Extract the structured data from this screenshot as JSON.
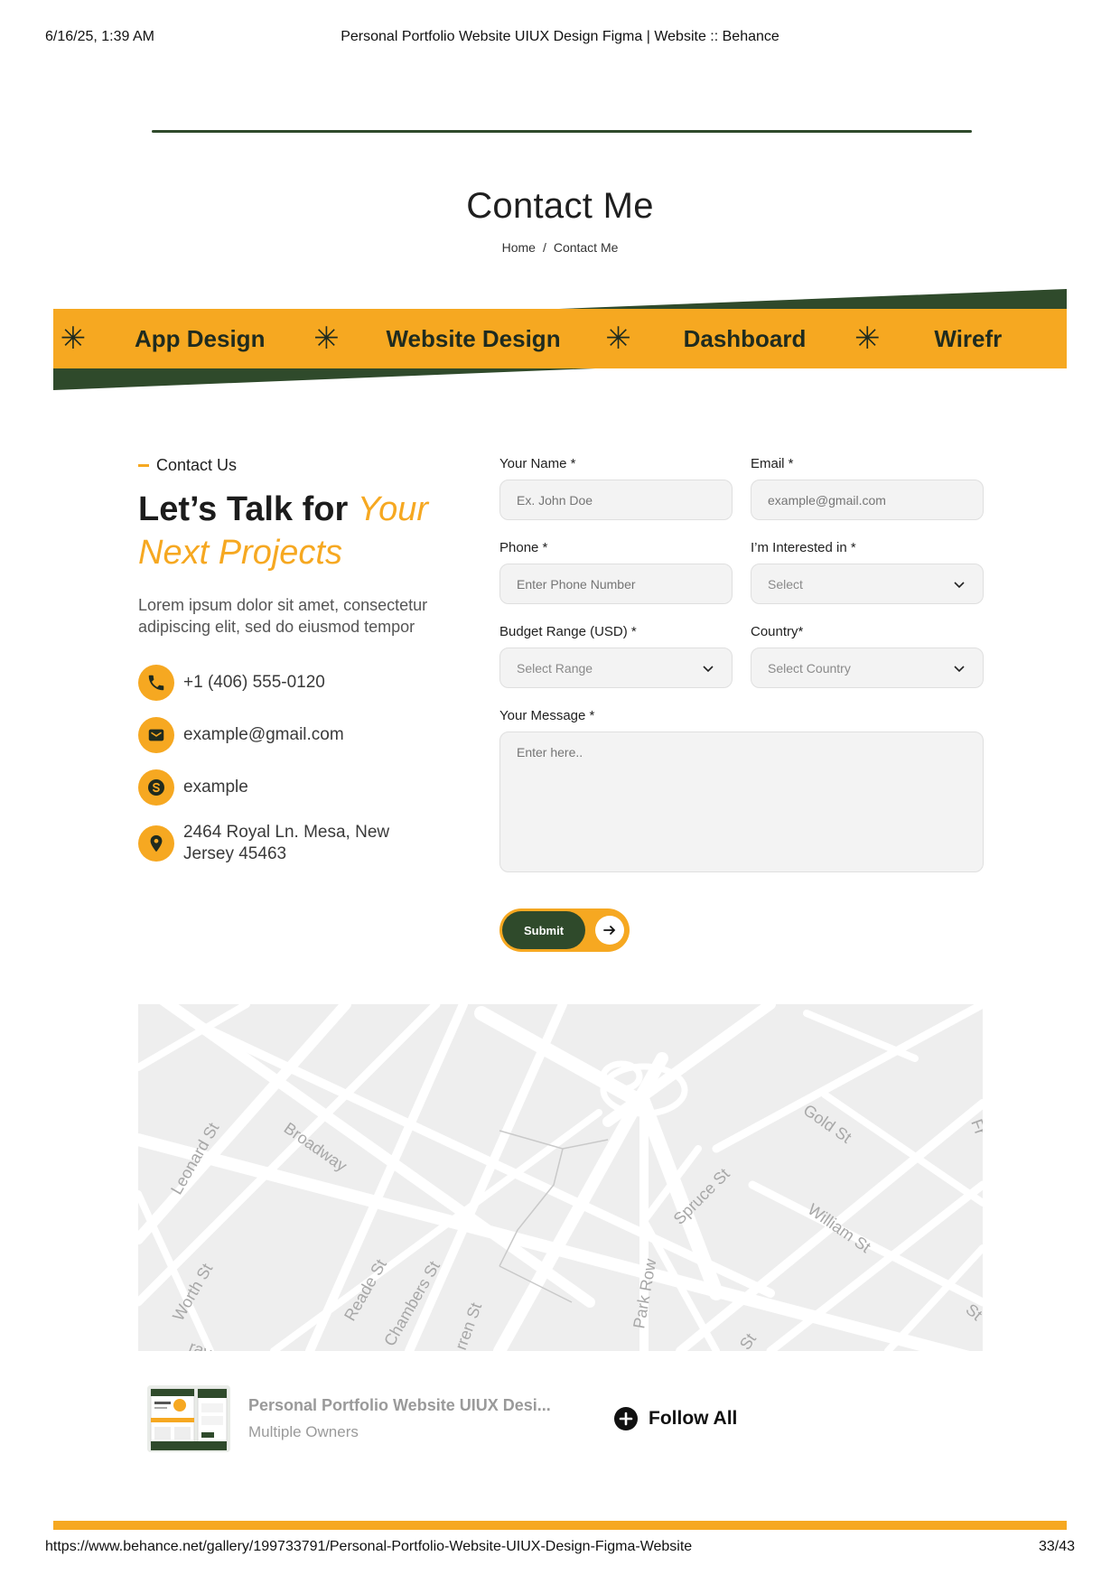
{
  "print_header": {
    "datetime": "6/16/25, 1:39 AM",
    "title": "Personal Portfolio Website UIUX Design Figma | Website :: Behance"
  },
  "page": {
    "title": "Contact Me",
    "breadcrumb": {
      "home": "Home",
      "separator": "/",
      "current": "Contact Me"
    }
  },
  "ribbon": {
    "items": [
      "App Design",
      "Website Design",
      "Dashboard",
      "Wirefr"
    ],
    "star_icon": "asterisk-icon",
    "colors": {
      "band": "#f6a821",
      "dark": "#2f4a2b"
    }
  },
  "contact_intro": {
    "eyebrow": "Contact Us",
    "headline_plain": "Let’s Talk for ",
    "headline_accent_1": "Your",
    "headline_accent_2": "Next Projects",
    "body": "Lorem ipsum dolor sit amet, consectetur adipiscing elit, sed do eiusmod tempor"
  },
  "contact_details": [
    {
      "icon": "phone-icon",
      "text": "+1 (406) 555-0120"
    },
    {
      "icon": "mail-icon",
      "text": "example@gmail.com"
    },
    {
      "icon": "skype-icon",
      "text": "example"
    },
    {
      "icon": "location-pin-icon",
      "text": "2464 Royal Ln. Mesa, New Jersey 45463"
    }
  ],
  "form": {
    "name": {
      "label": "Your Name *",
      "placeholder": "Ex. John Doe"
    },
    "email": {
      "label": "Email *",
      "placeholder": "example@gmail.com"
    },
    "phone": {
      "label": "Phone *",
      "placeholder": "Enter Phone Number"
    },
    "interest": {
      "label": "I’m Interested in *",
      "value": "Select"
    },
    "budget": {
      "label": "Budget Range (USD) *",
      "value": "Select Range"
    },
    "country": {
      "label": "Country*",
      "value": "Select Country"
    },
    "message": {
      "label": "Your Message *",
      "placeholder": "Enter here.."
    },
    "submit": "Submit"
  },
  "map": {
    "streets": [
      "Broadway",
      "Leonard St",
      "Worth St",
      "Reade St",
      "Chambers St",
      "rren St",
      "Park Row",
      "Spruce St",
      "Gold St",
      "William St",
      "St",
      "St",
      "Fr",
      "ray"
    ]
  },
  "project_bar": {
    "title": "Personal Portfolio Website UIUX Desi...",
    "owners": "Multiple Owners",
    "follow": "Follow All"
  },
  "print_footer": {
    "url": "https://www.behance.net/gallery/199733791/Personal-Portfolio-Website-UIUX-Design-Figma-Website",
    "page": "33/43"
  },
  "colors": {
    "accent": "#f6a821",
    "dark_green": "#2f4a2b"
  }
}
